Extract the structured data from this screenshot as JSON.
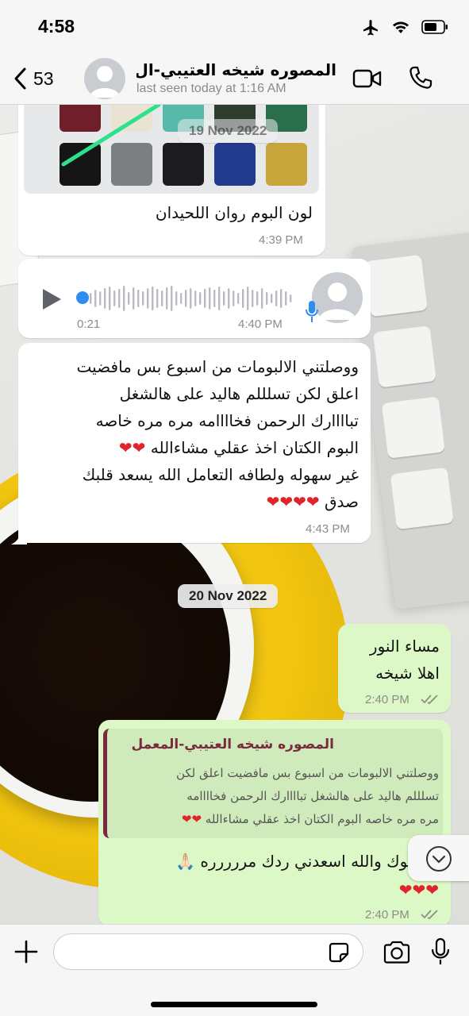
{
  "status_bar": {
    "time": "4:58",
    "icons": [
      "airplane-icon",
      "wifi-icon",
      "battery-icon"
    ]
  },
  "header": {
    "back_count": "53",
    "contact_name": "المصوره شيخه العتيبي-ال...",
    "last_seen": "last seen today at 1:16 AM",
    "icons": [
      "chevron-left-icon",
      "avatar-icon",
      "video-call-icon",
      "phone-icon"
    ]
  },
  "messages": [
    {
      "id": "m1",
      "direction": "incoming",
      "type": "image",
      "caption": "لون البوم روان اللحيدان",
      "time": "4:39 PM"
    },
    {
      "id": "m2",
      "direction": "incoming",
      "type": "voice",
      "duration": "0:21",
      "time": "4:40 PM"
    },
    {
      "id": "m3",
      "direction": "incoming",
      "type": "text",
      "lines": [
        "ووصلتني الالبومات من اسبوع بس مافضيت",
        "اعلق لكن تسلللم هاليد على هالشغل",
        "تباااارك الرحمن فخاااامه مره مره خاصه",
        "البوم الكتان اخذ عقلي مشاءالله ❤❤",
        "غير سهوله ولطافه التعامل الله يسعد قلبك",
        "صدق ❤❤❤❤"
      ],
      "time": "4:43 PM"
    },
    {
      "id": "m4",
      "direction": "outgoing",
      "type": "text",
      "lines": [
        "مساء النور",
        "اهلا شيخه"
      ],
      "time": "2:40 PM"
    },
    {
      "id": "m5",
      "direction": "outgoing",
      "type": "reply",
      "quote_author": "المصوره شيخه العتيبي-المعمل",
      "quote_lines": [
        "ووصلتني الالبومات من اسبوع بس مافضيت اعلق لكن",
        "تسلللم هاليد على هالشغل تباااارك الرحمن فخاااامه",
        "مره مره خاصه البوم الكتان اخذ عقلي مشاءالله ❤❤"
      ],
      "lines": [
        "لوك والله اسعدني ردك مررررره 🙏🏻",
        "❤❤❤"
      ],
      "time": "2:40 PM"
    }
  ],
  "date_chips": {
    "faded": "19 Nov 2022",
    "current": "20 Nov 2022"
  },
  "input_bar": {
    "placeholder": "",
    "icons": [
      "plus-icon",
      "sticker-icon",
      "camera-icon",
      "microphone-icon"
    ]
  },
  "colors": {
    "incoming_bubble": "#ffffff",
    "outgoing_bubble": "#dcf8c6",
    "accent_blue": "#2f8cf0",
    "quote_bar": "#7a2a3c",
    "heart": "#e0242b"
  }
}
